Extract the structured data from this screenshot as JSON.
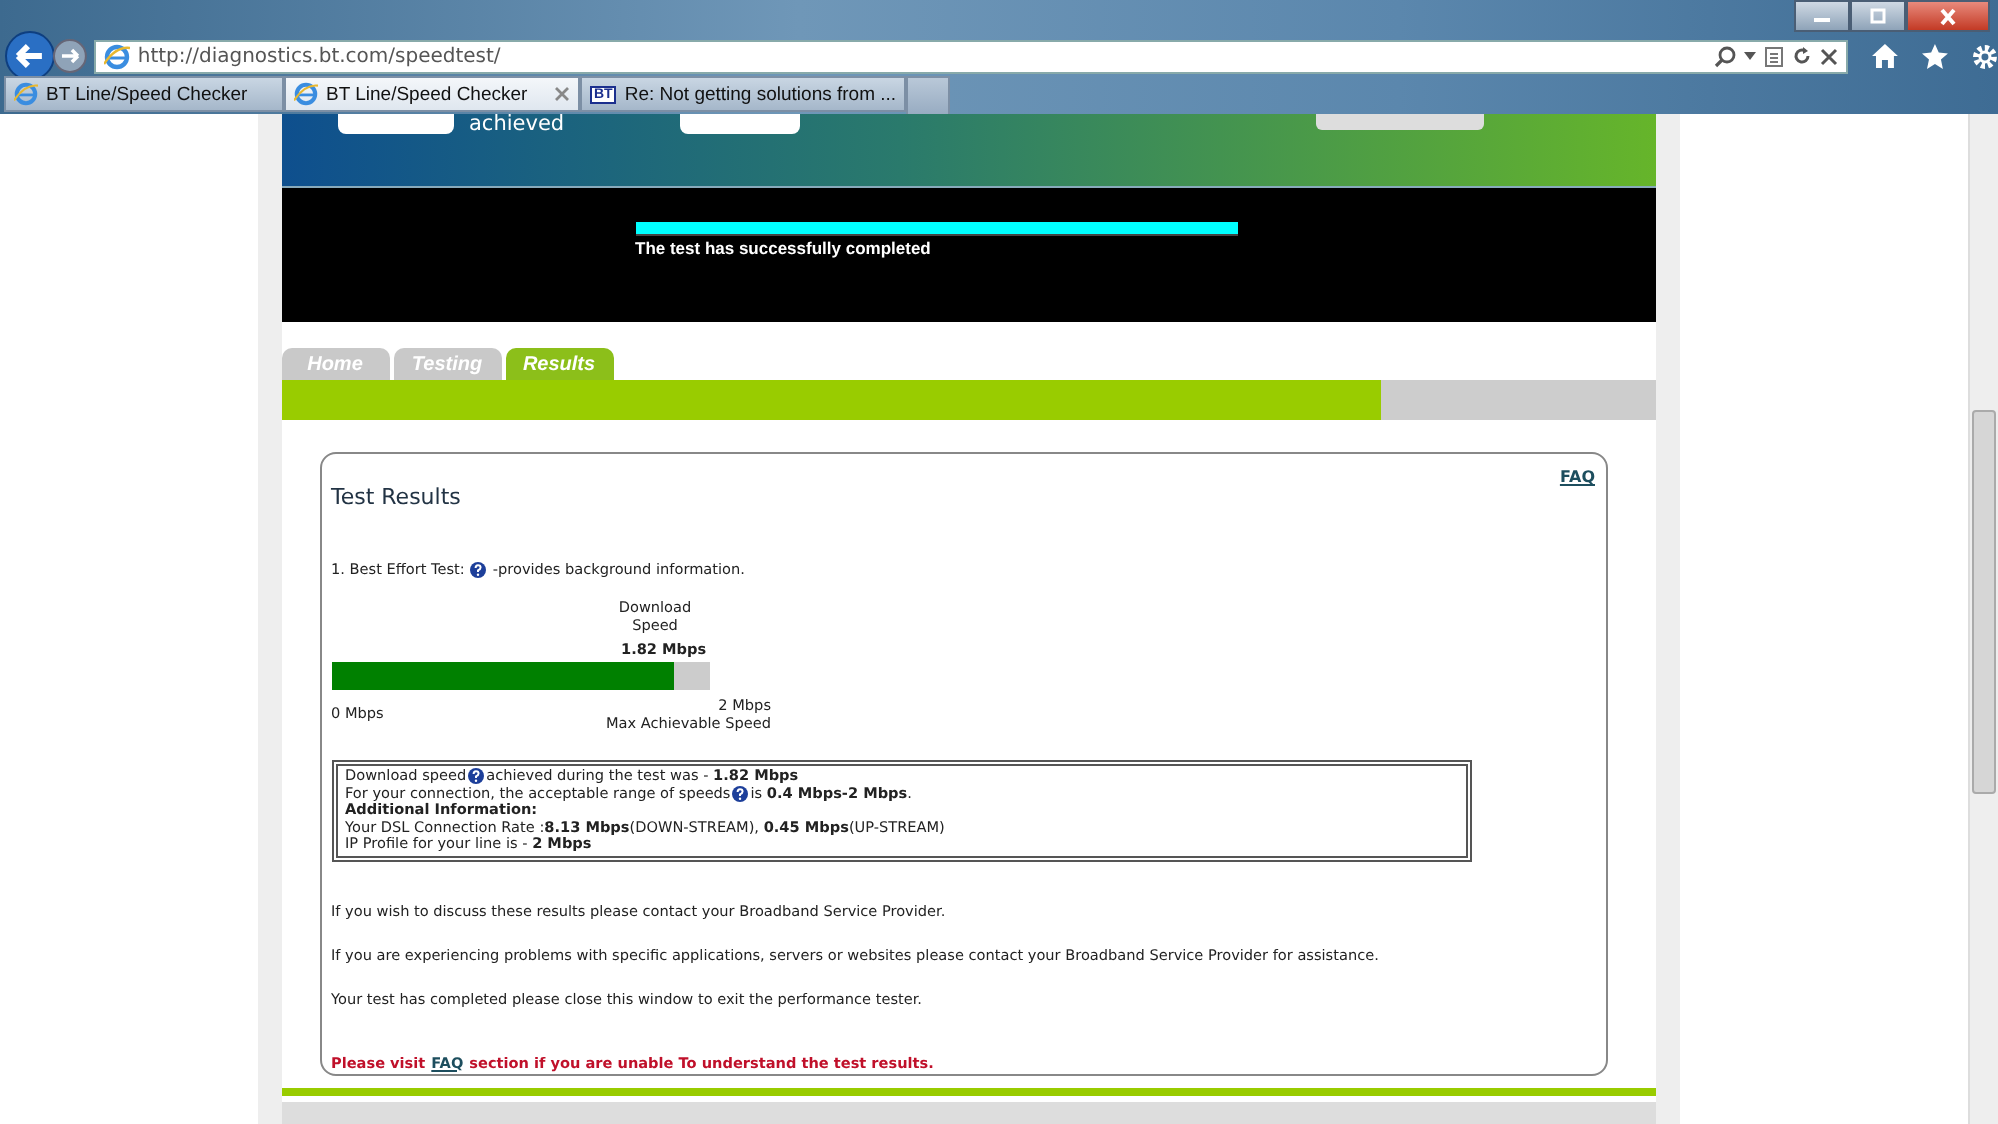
{
  "browser": {
    "address": "http://diagnostics.bt.com/speedtest/",
    "tabs": [
      {
        "kind": "ie",
        "title": "BT Line/Speed Checker",
        "selected": false
      },
      {
        "kind": "ie",
        "title": "BT Line/Speed Checker",
        "selected": true
      },
      {
        "kind": "logo",
        "badge": "BT",
        "title": "Re: Not getting solutions from ...",
        "selected": false
      }
    ]
  },
  "header": {
    "caption": "achieved"
  },
  "progress": {
    "level": 1,
    "message": "The test has successfully completed"
  },
  "nav_tabs": [
    {
      "label": "Home",
      "selected": false
    },
    {
      "label": "Testing",
      "selected": false
    },
    {
      "label": "Results",
      "selected": true
    }
  ],
  "results": {
    "title": "Test Results",
    "faq_link": "FAQ",
    "intro": "1. Best Effort Test:",
    "intro_note": "-provides background information.",
    "meter": {
      "heading": "Download Speed",
      "reading": "1.82 Mbps",
      "level": 0.91,
      "min_label": "0 Mbps",
      "max_label": "2 Mbps",
      "max_caption": "Max Achievable Speed"
    },
    "info": [
      {
        "kind": "help",
        "text": "Download speed",
        "after": "achieved during the test was - **1.82 Mbps**"
      },
      {
        "kind": "help",
        "text": "For your connection, the acceptable range of speeds",
        "after": " is **0.4 Mbps-2 Mbps**."
      },
      {
        "kind": "heading",
        "text": "Additional Information:"
      },
      {
        "kind": "text",
        "text": "Your DSL Connection Rate :**8.13 Mbps**(DOWN-STREAM), **0.45 Mbps**(UP-STREAM)"
      },
      {
        "kind": "text",
        "text": "IP Profile for your line is - **2 Mbps**"
      }
    ],
    "paragraphs": [
      "If you wish to discuss these results please contact your Broadband Service Provider.",
      "If you are experiencing problems with specific applications, servers or websites please contact your Broadband Service Provider for assistance.",
      "Your test has completed please close this window to exit the performance tester."
    ],
    "notice": {
      "before": "Please visit",
      "link": "FAQ",
      "after": "section if you are unable To understand the test results."
    }
  }
}
